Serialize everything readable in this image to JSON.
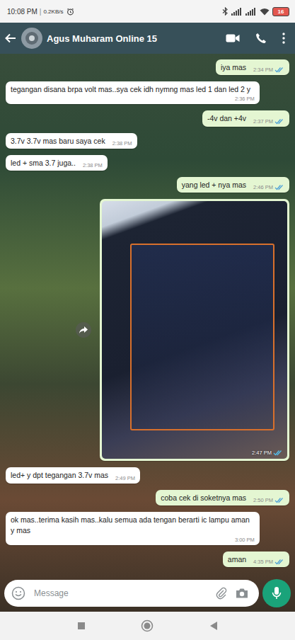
{
  "status_bar": {
    "time": "10:08 PM",
    "speed": "0.2KB/s",
    "battery": "16"
  },
  "header": {
    "title": "Agus Muharam Online 15"
  },
  "messages": [
    {
      "kind": "text",
      "side": "out",
      "text": "iya mas",
      "time": "2:34 PM",
      "read": true
    },
    {
      "kind": "text",
      "side": "in",
      "text": "tegangan disana brpa volt mas..sya cek idh nymng mas led 1 dan led 2 y",
      "time": "2:36 PM"
    },
    {
      "kind": "text",
      "side": "out",
      "text": "-4v dan +4v",
      "time": "2:37 PM",
      "read": true
    },
    {
      "kind": "text",
      "side": "in",
      "text": "3.7v 3.7v mas baru saya cek",
      "time": "2:38 PM"
    },
    {
      "kind": "text",
      "side": "in",
      "text": "led + sma 3.7  juga..",
      "time": "2:38 PM"
    },
    {
      "kind": "text",
      "side": "out",
      "text": "yang led + nya mas",
      "time": "2:46 PM",
      "read": true
    },
    {
      "kind": "image",
      "side": "out",
      "text": "",
      "time": "2:47 PM",
      "read": true
    },
    {
      "kind": "text",
      "side": "in",
      "text": "led+ y dpt tegangan 3.7v mas",
      "time": "2:49 PM"
    },
    {
      "kind": "text",
      "side": "out",
      "text": "coba cek di soketnya mas",
      "time": "2:50 PM",
      "read": true
    },
    {
      "kind": "text",
      "side": "in",
      "text": "ok mas..terima kasih mas..kalu semua ada tengan berarti ic lampu aman y mas",
      "time": "3:00 PM"
    },
    {
      "kind": "text",
      "side": "out",
      "text": "aman",
      "time": "4:35 PM",
      "read": true
    }
  ],
  "composer": {
    "placeholder": "Message"
  }
}
